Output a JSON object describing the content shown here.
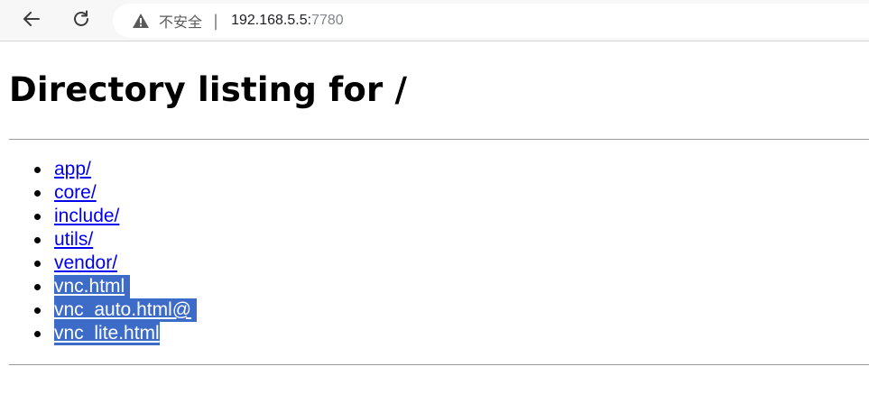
{
  "browser": {
    "security_label": "不安全",
    "separator": "|",
    "url_host": "192.168.5.5:",
    "url_port": "7780"
  },
  "page": {
    "title": "Directory listing for /",
    "entries": [
      {
        "name": "app/",
        "selected": false
      },
      {
        "name": "core/",
        "selected": false
      },
      {
        "name": "include/",
        "selected": false
      },
      {
        "name": "utils/",
        "selected": false
      },
      {
        "name": "vendor/",
        "selected": false
      },
      {
        "name": "vnc.html",
        "selected": true
      },
      {
        "name": "vnc_auto.html@",
        "selected": true
      },
      {
        "name": "vnc_lite.html",
        "selected": true
      }
    ]
  },
  "colors": {
    "link": "#0000ee",
    "selection": "#3c6bc8"
  }
}
